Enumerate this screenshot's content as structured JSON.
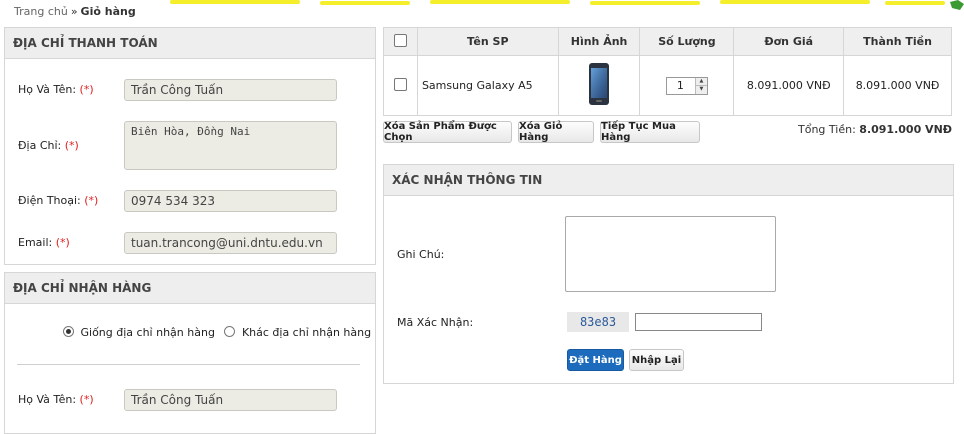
{
  "breadcrumb": {
    "home": "Trang chủ",
    "separator": "»",
    "current": "Giỏ hàng"
  },
  "billing": {
    "title": "ĐỊA CHỈ THANH TOÁN",
    "name_label": "Họ Và Tên:",
    "name_value": "Trần Công Tuấn",
    "address_label": "Địa Chỉ:",
    "address_value": "Biên Hòa, Đồng Nai",
    "phone_label": "Điện Thoại:",
    "phone_value": "0974 534 323",
    "email_label": "Email:",
    "email_value": "tuan.trancong@uni.dntu.edu.vn",
    "required_mark": "(*)"
  },
  "shipping": {
    "title": "ĐỊA CHỈ NHẬN HÀNG",
    "option_same": "Giống địa chỉ nhận hàng",
    "option_other": "Khác địa chỉ nhận hàng",
    "selected": "same",
    "name_label": "Họ Và Tên:",
    "name_value": "Trần Công Tuấn"
  },
  "cart": {
    "headers": [
      "Tên SP",
      "Hình Ảnh",
      "Số Lượng",
      "Đơn Giá",
      "Thành Tiền"
    ],
    "items": [
      {
        "name": "Samsung Galaxy A5",
        "image": "phone-image",
        "quantity": "1",
        "unit_price": "8.091.000 VNĐ",
        "subtotal": "8.091.000 VNĐ"
      }
    ],
    "buttons": {
      "remove_selected": "Xóa Sản Phẩm Được Chọn",
      "clear_cart": "Xóa Giỏ Hàng",
      "continue": "Tiếp Tục Mua Hàng"
    },
    "total_label": "Tổng Tiền:",
    "total_value": "8.091.000 VNĐ"
  },
  "confirm": {
    "title": "XÁC NHẬN THÔNG TIN",
    "note_label": "Ghi Chú:",
    "captcha_label": "Mã Xác Nhận:",
    "captcha_code": "83e83",
    "submit": "Đặt Hàng",
    "reset": "Nhập Lại"
  },
  "colors": {
    "accent": "#1d6bbd",
    "required": "#e02020",
    "header_bg": "#eeeeee",
    "stripe": "#f5ee2a"
  }
}
